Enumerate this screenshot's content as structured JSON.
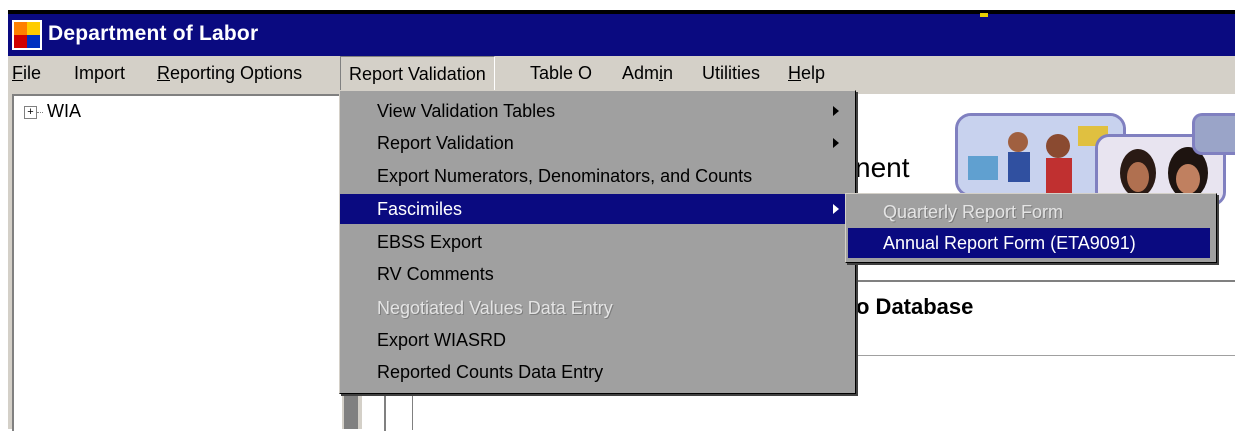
{
  "window": {
    "title": "Department of Labor",
    "app_icon": "app-window-icon"
  },
  "menubar": {
    "items": [
      {
        "label": "File",
        "underline": "F"
      },
      {
        "label": "Import"
      },
      {
        "label": "Reporting Options",
        "underline": "R"
      },
      {
        "label": "Report Validation",
        "active": true
      },
      {
        "label": "Table O"
      },
      {
        "label": "Admin",
        "underline": "i"
      },
      {
        "label": "Utilities"
      },
      {
        "label": "Help",
        "underline": "H"
      }
    ]
  },
  "tree": {
    "root_label": "WIA",
    "expander": "+"
  },
  "dropdown": {
    "items": [
      {
        "label": "View Validation Tables",
        "submenu": true
      },
      {
        "label": "Report Validation",
        "submenu": true
      },
      {
        "label": "Export Numerators, Denominators, and Counts"
      },
      {
        "label": "Fascimiles",
        "submenu": true,
        "highlighted": true
      },
      {
        "label": "EBSS Export"
      },
      {
        "label": "RV Comments"
      },
      {
        "label": "Negotiated Values Data Entry",
        "disabled": true
      },
      {
        "label": "Export WIASRD"
      },
      {
        "label": "Reported Counts Data Entry"
      }
    ]
  },
  "submenu": {
    "items": [
      {
        "label": "Quarterly Report Form",
        "disabled": true
      },
      {
        "label": "Annual Report Form (ETA9091)",
        "highlighted": true
      }
    ]
  },
  "content": {
    "heading_fragment": "nent",
    "db_fragment": "o Database"
  },
  "colors": {
    "titlebar": "#0a0a80",
    "menu_bg": "#a0a0a0",
    "highlight": "#0a0a80"
  }
}
